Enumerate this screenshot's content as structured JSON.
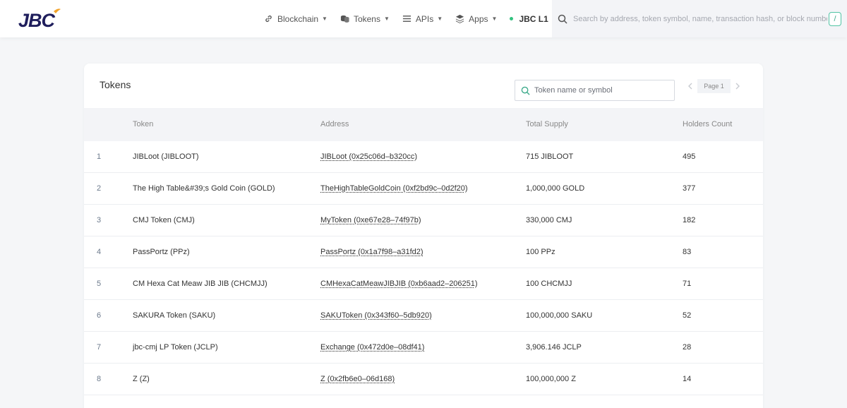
{
  "brand": {
    "logo_text": "JBC",
    "accent": "#f2a32a",
    "logo_color": "#1f1e5c"
  },
  "nav": {
    "items": [
      {
        "label": "Blockchain",
        "icon": "link-icon"
      },
      {
        "label": "Tokens",
        "icon": "coins-icon"
      },
      {
        "label": "APIs",
        "icon": "list-icon"
      },
      {
        "label": "Apps",
        "icon": "layers-icon"
      }
    ],
    "network": "JBC L1",
    "network_status_color": "#33c27f"
  },
  "search": {
    "placeholder": "Search by address, token symbol, name, transaction hash, or block number",
    "shortcut": "/"
  },
  "tokens": {
    "title": "Tokens",
    "filter_placeholder": "Token name or symbol",
    "page_label": "Page 1",
    "columns": [
      "Token",
      "Address",
      "Total Supply",
      "Holders Count"
    ],
    "rows": [
      {
        "index": "1",
        "token": "JIBLoot (JIBLOOT)",
        "address": "JIBLoot (0x25c06d–b320cc)",
        "supply": "715 JIBLOOT",
        "holders": "495"
      },
      {
        "index": "2",
        "token": "The High Table&#39;s Gold Coin (GOLD)",
        "address": "TheHighTableGoldCoin (0xf2bd9c–0d2f20)",
        "supply": "1,000,000 GOLD",
        "holders": "377"
      },
      {
        "index": "3",
        "token": "CMJ Token (CMJ)",
        "address": "MyToken (0xe67e28–74f97b)",
        "supply": "330,000 CMJ",
        "holders": "182"
      },
      {
        "index": "4",
        "token": "PassPortz (PPz)",
        "address": "PassPortz (0x1a7f98–a31fd2)",
        "supply": "100 PPz",
        "holders": "83"
      },
      {
        "index": "5",
        "token": "CM Hexa Cat Meaw JIB JIB (CHCMJJ)",
        "address": "CMHexaCatMeawJIBJIB (0xb6aad2–206251)",
        "supply": "100 CHCMJJ",
        "holders": "71"
      },
      {
        "index": "6",
        "token": "SAKURA Token (SAKU)",
        "address": "SAKUToken (0x343f60–5db920)",
        "supply": "100,000,000 SAKU",
        "holders": "52"
      },
      {
        "index": "7",
        "token": "jbc-cmj LP Token (JCLP)",
        "address": "Exchange (0x472d0e–08df41)",
        "supply": "3,906.146 JCLP",
        "holders": "28"
      },
      {
        "index": "8",
        "token": "Z (Z)",
        "address": "Z (0x2fb6e0–06d168)",
        "supply": "100,000,000 Z",
        "holders": "14"
      }
    ]
  }
}
